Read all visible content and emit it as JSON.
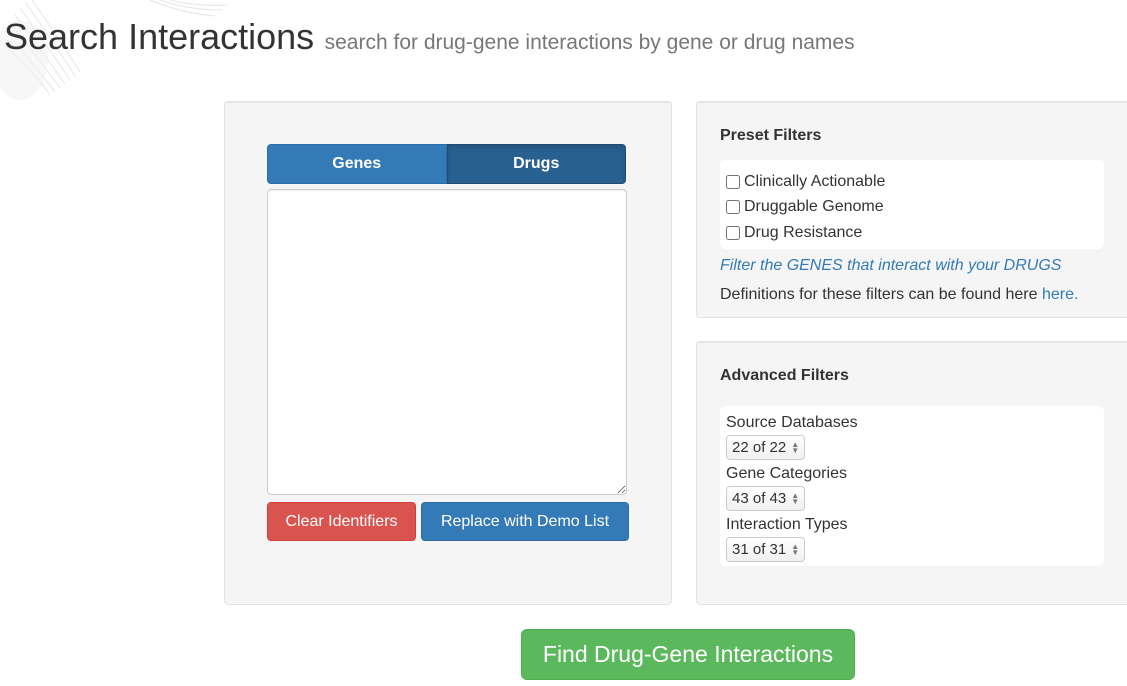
{
  "header": {
    "title": "Search Interactions",
    "subtitle": "search for drug-gene interactions by gene or drug names"
  },
  "input_panel": {
    "tabs": [
      {
        "label": "Genes",
        "active": false
      },
      {
        "label": "Drugs",
        "active": true
      }
    ],
    "textarea_value": "",
    "clear_label": "Clear Identifiers",
    "demo_label": "Replace with Demo List"
  },
  "preset_filters": {
    "heading": "Preset Filters",
    "options": [
      {
        "label": "Clinically Actionable",
        "checked": false
      },
      {
        "label": "Druggable Genome",
        "checked": false
      },
      {
        "label": "Drug Resistance",
        "checked": false
      }
    ],
    "filter_note": "Filter the GENES that interact with your DRUGS",
    "definitions_text": "Definitions for these filters can be found here",
    "definitions_link": "here."
  },
  "advanced_filters": {
    "heading": "Advanced Filters",
    "groups": [
      {
        "label": "Source Databases",
        "value": "22 of 22"
      },
      {
        "label": "Gene Categories",
        "value": "43 of 43"
      },
      {
        "label": "Interaction Types",
        "value": "31 of 31"
      }
    ]
  },
  "find_button": "Find Drug-Gene Interactions",
  "colors": {
    "primary": "#337ab7",
    "primary_active": "#286090",
    "danger": "#d9534f",
    "success": "#5cb85c",
    "well": "#f5f5f5"
  }
}
